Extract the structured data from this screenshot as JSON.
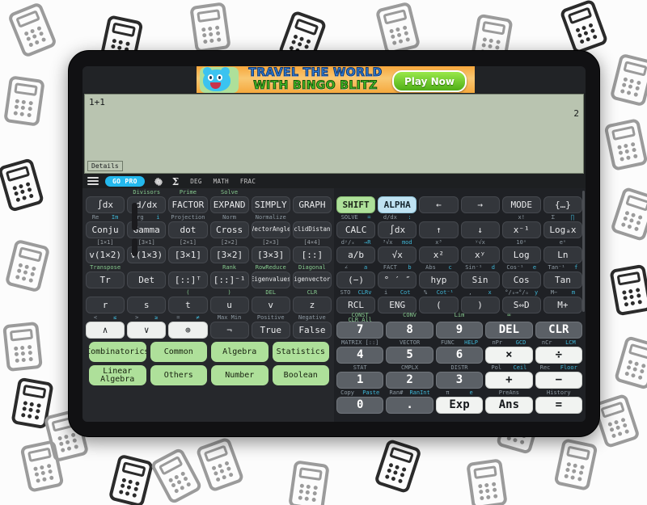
{
  "wallpaper": {
    "icon_name": "calculator-icon"
  },
  "ad": {
    "line1": "TRAVEL THE WORLD",
    "line2": "WITH BINGO BLITZ",
    "cta": "Play Now",
    "mascot": "cat-mascot-icon"
  },
  "display": {
    "expression": "1+1",
    "result": "2",
    "details_label": "Details"
  },
  "toolbar": {
    "menu_icon": "hamburger-menu-icon",
    "go_pro_label": "GO PRO",
    "settings_icon": "gear-icon",
    "sigma_icon": "sigma-icon",
    "tags": [
      "DEG",
      "MATH",
      "FRAC"
    ]
  },
  "left_pad": {
    "rows": [
      {
        "headers": [
          "",
          "Divisors",
          "Prime",
          "Solve",
          "",
          ""
        ],
        "keys": [
          "∫dx",
          "d/dx",
          "FACTOR",
          "EXPAND",
          "SIMPLY",
          "GRAPH"
        ]
      },
      {
        "headers_split": [
          [
            "Re",
            "Im"
          ],
          [
            "Arg",
            "i"
          ],
          [
            "Projection",
            ""
          ],
          [
            "Norm",
            ""
          ],
          [
            "Normalize",
            ""
          ],
          [
            "",
            ""
          ]
        ],
        "keys": [
          "Conju",
          "Gamma",
          "dot",
          "Cross",
          "VectorAngle",
          "EuclidDistance"
        ]
      },
      {
        "headers": [
          "[1×1]",
          "[3×1]",
          "[2×1]",
          "[2×2]",
          "[2×3]",
          "[4×4]"
        ],
        "keys": [
          "v(1×2)",
          "v(1×3)",
          "[3×1]",
          "[3×2]",
          "[3×3]",
          "[::]"
        ]
      },
      {
        "headers": [
          "Transpose",
          "",
          "",
          "Rank",
          "RowReduce",
          "Diagonal"
        ],
        "keys": [
          "Tr",
          "Det",
          "[::]ᵀ",
          "[::]⁻¹",
          "Eigenvalues",
          "Eigenvectors"
        ]
      },
      {
        "headers": [
          "",
          "",
          "(",
          ")",
          "DEL",
          "CLR"
        ],
        "keys": [
          "r",
          "s",
          "t",
          "u",
          "v",
          "z"
        ]
      },
      {
        "headers_split": [
          [
            "<",
            "≤"
          ],
          [
            ">",
            "≥"
          ],
          [
            "=",
            "≠"
          ],
          [
            "Max Min",
            ""
          ],
          [
            "Positive",
            ""
          ],
          [
            "Negative",
            ""
          ]
        ],
        "keys": [
          "∧",
          "∨",
          "⊕",
          "¬",
          "True",
          "False"
        ]
      }
    ],
    "categories": [
      [
        "Combinatorics",
        "Common",
        "Algebra",
        "Statistics"
      ],
      [
        "Linear Algebra",
        "Others",
        "Number",
        "Boolean"
      ]
    ]
  },
  "right_pad": {
    "rows": [
      {
        "headers": [
          "",
          "",
          "",
          "",
          "",
          ""
        ],
        "keys": [
          "SHIFT",
          "ALPHA",
          "←",
          "→",
          "MODE",
          "{…}"
        ]
      },
      {
        "headers_split": [
          [
            "SOLVE",
            "="
          ],
          [
            "d/dx",
            ":"
          ],
          [
            "",
            ""
          ],
          [
            "",
            ""
          ],
          [
            "x!",
            ""
          ],
          [
            "Σ",
            "∏"
          ]
        ],
        "keys": [
          "CALC",
          "∫dx",
          "↑",
          "↓",
          "x⁻¹",
          "Logₐx"
        ]
      },
      {
        "headers_split": [
          [
            "dʸ/ₓ",
            "→R"
          ],
          [
            "³√x",
            "mod"
          ],
          [
            "x³",
            ""
          ],
          [
            "ʸ√x",
            ""
          ],
          [
            "10ˣ",
            ""
          ],
          [
            "eˣ",
            ""
          ]
        ],
        "keys": [
          "a/b",
          "√x",
          "x²",
          "xʸ",
          "Log",
          "Ln"
        ]
      },
      {
        "headers_split": [
          [
            "∠",
            "a"
          ],
          [
            "FACT",
            "b"
          ],
          [
            "Abs",
            "c"
          ],
          [
            "Sin⁻¹",
            "d"
          ],
          [
            "Cos⁻¹",
            "e"
          ],
          [
            "Tan⁻¹",
            "f"
          ]
        ],
        "keys": [
          "(−)",
          "° ′ ″",
          "hyp",
          "Sin",
          "Cos",
          "Tan"
        ]
      },
      {
        "headers_split": [
          [
            "STO",
            "CLRv"
          ],
          [
            "i",
            "Cot"
          ],
          [
            "%",
            "Cot⁻¹"
          ],
          [
            ",",
            "x"
          ],
          [
            "°/ₒ→°/ₒ",
            "y"
          ],
          [
            "M−",
            "m"
          ]
        ],
        "keys": [
          "RCL",
          "ENG",
          "(",
          ")",
          "S⇔D",
          "M+"
        ]
      },
      {
        "headers": [
          "CONST",
          "CONV",
          "Lim",
          "∞",
          "",
          "CLR All"
        ],
        "keys": [
          "7",
          "8",
          "9",
          "DEL",
          "CLR"
        ]
      },
      {
        "headers_split": [
          [
            "MATRIX [::]",
            ""
          ],
          [
            "VECTOR",
            ""
          ],
          [
            "FUNC",
            "HELP"
          ],
          [
            "nPr",
            "GCD"
          ],
          [
            "nCr",
            "LCM"
          ]
        ],
        "keys": [
          "4",
          "5",
          "6",
          "×",
          "÷"
        ]
      },
      {
        "headers_split": [
          [
            "STAT",
            ""
          ],
          [
            "CMPLX",
            ""
          ],
          [
            "DISTR",
            ""
          ],
          [
            "Pol",
            "Ceil"
          ],
          [
            "Rec",
            "Floor"
          ]
        ],
        "keys": [
          "1",
          "2",
          "3",
          "+",
          "−"
        ]
      },
      {
        "headers_split": [
          [
            "Copy",
            "Paste"
          ],
          [
            "Ran#",
            "RanInt"
          ],
          [
            "π",
            "e"
          ],
          [
            "PreAns",
            ""
          ],
          [
            "History",
            ""
          ]
        ],
        "keys": [
          "0",
          ".",
          "Exp",
          "Ans",
          "="
        ]
      }
    ]
  },
  "colors": {
    "accent_blue": "#24b9ee",
    "green_key": "#aee09a",
    "blue_key": "#bfe2f2",
    "display_bg": "#b9c4b0",
    "header_green": "#86c98e"
  }
}
